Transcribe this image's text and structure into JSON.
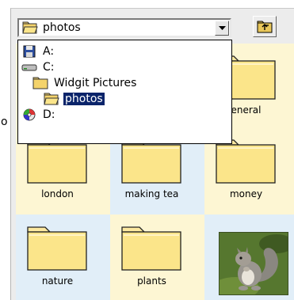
{
  "stray_char": "o",
  "combo": {
    "value": "photos"
  },
  "dropdown": {
    "items": [
      {
        "label": "A:",
        "icon": "floppy-drive-icon",
        "depth": 0,
        "selected": false
      },
      {
        "label": "C:",
        "icon": "hard-drive-icon",
        "depth": 0,
        "selected": false
      },
      {
        "label": "Widgit Pictures",
        "icon": "folder-icon",
        "depth": 1,
        "selected": false
      },
      {
        "label": "photos",
        "icon": "open-folder-icon",
        "depth": 2,
        "selected": true
      },
      {
        "label": "D:",
        "icon": "cd-drive-icon",
        "depth": 0,
        "selected": false
      }
    ]
  },
  "grid": {
    "items": [
      {
        "label": "",
        "kind": "folder"
      },
      {
        "label": "",
        "kind": "folder"
      },
      {
        "label": "eneral",
        "kind": "folder"
      },
      {
        "label": "london",
        "kind": "folder"
      },
      {
        "label": "making tea",
        "kind": "folder"
      },
      {
        "label": "money",
        "kind": "folder"
      },
      {
        "label": "nature",
        "kind": "folder"
      },
      {
        "label": "plants",
        "kind": "folder"
      },
      {
        "label": "",
        "kind": "image",
        "icon": "squirrel-photo"
      }
    ]
  },
  "colors": {
    "cell_cream": "#fdf6d3",
    "cell_blue": "#e1eef8",
    "folder_fill": "#fbe58a",
    "selection": "#0a246a"
  }
}
